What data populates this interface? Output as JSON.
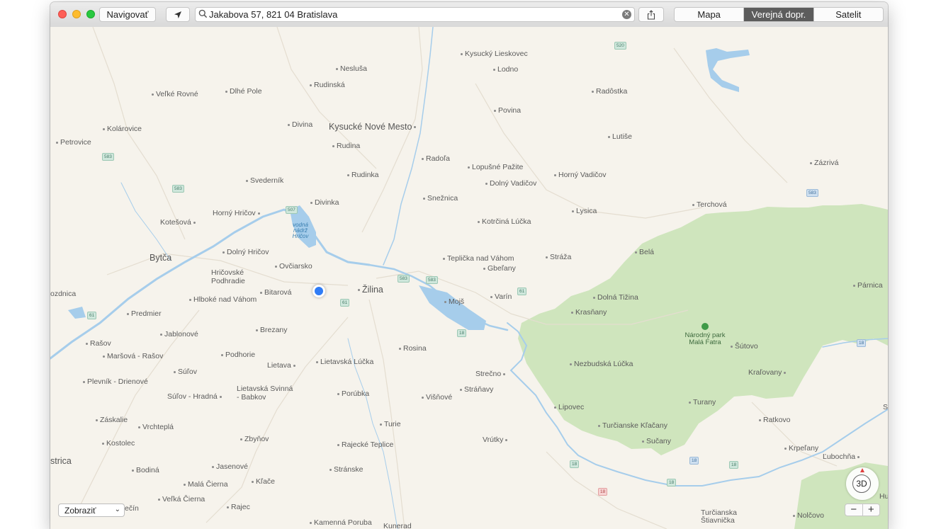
{
  "toolbar": {
    "navigate_label": "Navigovať",
    "search_value": "Jakabova 57, 821 04 Bratislava",
    "map_modes": [
      "Mapa",
      "Verejná dopr.",
      "Satelit"
    ],
    "active_mode": "Verejná dopr."
  },
  "map": {
    "colors": {
      "land": "#f6f3ec",
      "park": "#cfe5bd",
      "water": "#a6cdeb",
      "user_location": "#2f7cf6"
    },
    "cities": [
      "Žilina",
      "Bytča",
      "Kysucké Nové Mesto"
    ],
    "places": [
      "Kysucký Lieskovec",
      "Lodno",
      "Nesluša",
      "Rudinská",
      "Veľké Rovné",
      "Dlhé Pole",
      "Radôstka",
      "Povina",
      "Kolárovice",
      "Petrovice",
      "Divina",
      "Rudina",
      "Lutiše",
      "Radoľa",
      "Lopušné Pažite",
      "Rudinka",
      "Svederník",
      "Horný Vadičov",
      "Dolný Vadičov",
      "Zázrivá",
      "Snežnica",
      "Divinka",
      "Terchová",
      "Kotešová",
      "Horný Hričov",
      "Lysica",
      "Kotrčiná Lúčka",
      "Dolný Hričov",
      "Belá",
      "Teplička nad Váhom",
      "Stráža",
      "Gbeľany",
      "Ovčiarsko",
      "Hričovské Podhradie",
      "Bitarová",
      "ozdnica",
      "Hlboké nad Váhom",
      "Varín",
      "Mojš",
      "Dolná Tižina",
      "Párnica",
      "Predmier",
      "Krasňany",
      "Brezany",
      "Jablonové",
      "Šútovo",
      "Rašov",
      "Rosina",
      "Maršová - Rašov",
      "Podhorie",
      "Lietava",
      "Lietavská Lúčka",
      "Nezbudská Lúčka",
      "Súľov",
      "Strečno",
      "Kraľovany",
      "Plevník - Drienové",
      "Lietavská Svinná - Babkov",
      "Stráňavy",
      "Súľov - Hradná",
      "Porúbka",
      "Višňové",
      "Turany",
      "Lipovec",
      "Záskalie",
      "Turie",
      "Ratkovo",
      "Vrchteplá",
      "Turčianske Kľačany",
      "Kostolec",
      "Zbyňov",
      "Rajecké Teplice",
      "Vrútky",
      "Sučany",
      "Krpeľany",
      "strica",
      "Ľubochňa",
      "Bodiná",
      "Jasenové",
      "Stránske",
      "Malá Čierna",
      "Kľače",
      "Veľká Čierna",
      "Rajec",
      "ečín",
      "Turčianska Štiavnička",
      "Nolčovo",
      "Kamenná Poruba",
      "Kunerad",
      "Hu",
      "S"
    ],
    "water_label": "vodná nádrž Hričov",
    "park_label": "Národný park Malá Fatra",
    "road_shields": [
      "520",
      "583",
      "583",
      "507",
      "583",
      "61",
      "583",
      "61",
      "18",
      "61",
      "583",
      "18",
      "18",
      "18",
      "18",
      "18",
      "18"
    ]
  },
  "controls": {
    "show_label": "Zobraziť",
    "three_d_label": "3D",
    "zoom_out": "−",
    "zoom_in": "+"
  }
}
